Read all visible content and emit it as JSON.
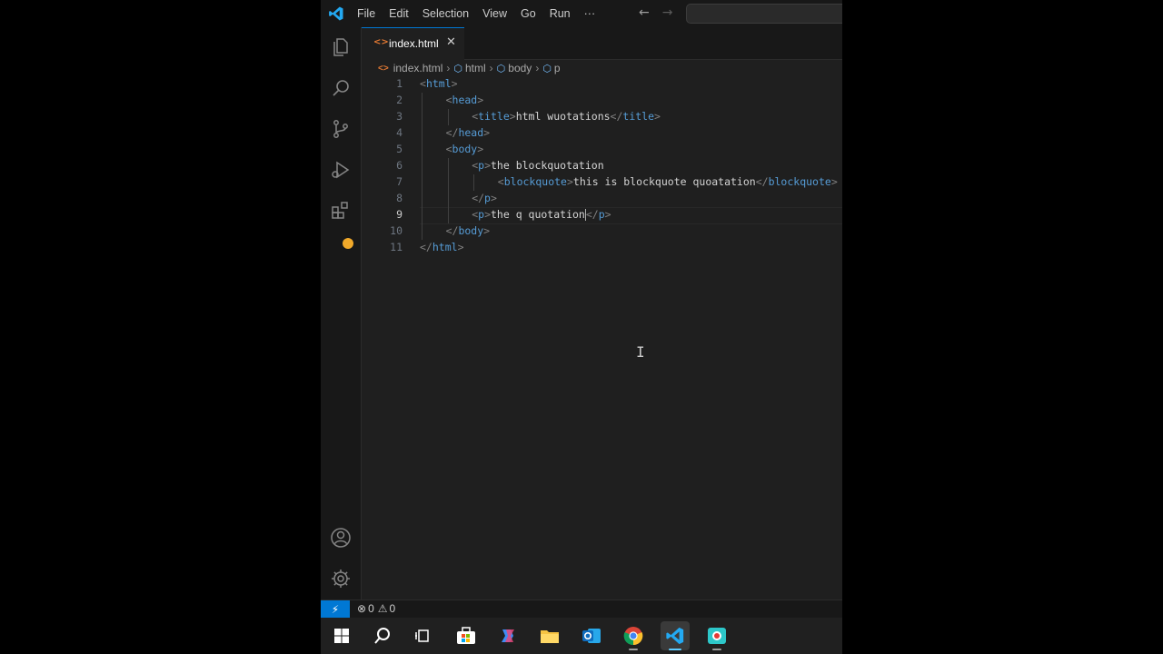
{
  "titlebar": {
    "menu": [
      "File",
      "Edit",
      "Selection",
      "View",
      "Go",
      "Run",
      "···"
    ]
  },
  "activity_bar": {
    "icons": [
      "explorer-icon",
      "search-icon",
      "source-control-icon",
      "run-debug-icon",
      "extensions-icon",
      "accounts-icon",
      "settings-gear-icon"
    ]
  },
  "tab": {
    "name": "index.html",
    "close": "✕"
  },
  "breadcrumb": [
    "index.html",
    "html",
    "body",
    "p"
  ],
  "editor": {
    "lines": [
      {
        "n": "1",
        "indent": 0,
        "parts": [
          [
            "g",
            "<"
          ],
          [
            "t",
            "html"
          ],
          [
            "g",
            ">"
          ]
        ]
      },
      {
        "n": "2",
        "indent": 1,
        "parts": [
          [
            "g",
            "<"
          ],
          [
            "t",
            "head"
          ],
          [
            "g",
            ">"
          ]
        ]
      },
      {
        "n": "3",
        "indent": 2,
        "parts": [
          [
            "g",
            "<"
          ],
          [
            "t",
            "title"
          ],
          [
            "g",
            ">"
          ],
          [
            "x",
            "html wuotations"
          ],
          [
            "g",
            "</"
          ],
          [
            "t",
            "title"
          ],
          [
            "g",
            ">"
          ]
        ]
      },
      {
        "n": "4",
        "indent": 1,
        "parts": [
          [
            "g",
            "</"
          ],
          [
            "t",
            "head"
          ],
          [
            "g",
            ">"
          ]
        ]
      },
      {
        "n": "5",
        "indent": 1,
        "parts": [
          [
            "g",
            "<"
          ],
          [
            "t",
            "body"
          ],
          [
            "g",
            ">"
          ]
        ]
      },
      {
        "n": "6",
        "indent": 2,
        "parts": [
          [
            "g",
            "<"
          ],
          [
            "t",
            "p"
          ],
          [
            "g",
            ">"
          ],
          [
            "x",
            "the blockquotation"
          ]
        ]
      },
      {
        "n": "7",
        "indent": 3,
        "parts": [
          [
            "g",
            "<"
          ],
          [
            "t",
            "blockquote"
          ],
          [
            "g",
            ">"
          ],
          [
            "x",
            "this is blockquote quoatation"
          ],
          [
            "g",
            "</"
          ],
          [
            "t",
            "blockquote"
          ],
          [
            "g",
            ">"
          ]
        ]
      },
      {
        "n": "8",
        "indent": 2,
        "parts": [
          [
            "g",
            "</"
          ],
          [
            "t",
            "p"
          ],
          [
            "g",
            ">"
          ]
        ]
      },
      {
        "n": "9",
        "indent": 2,
        "current": true,
        "parts": [
          [
            "g",
            "<"
          ],
          [
            "t",
            "p"
          ],
          [
            "g",
            ">"
          ],
          [
            "x",
            "the q quotation"
          ],
          [
            "c",
            ""
          ],
          [
            "g",
            "</"
          ],
          [
            "t",
            "p"
          ],
          [
            "g",
            ">"
          ]
        ]
      },
      {
        "n": "10",
        "indent": 1,
        "parts": [
          [
            "g",
            "</"
          ],
          [
            "t",
            "body"
          ],
          [
            "g",
            ">"
          ]
        ]
      },
      {
        "n": "11",
        "indent": 0,
        "parts": [
          [
            "g",
            "</"
          ],
          [
            "t",
            "html"
          ],
          [
            "g",
            ">"
          ]
        ]
      }
    ]
  },
  "statusbar": {
    "remote": "⚡",
    "errors": "0",
    "warnings": "0"
  },
  "taskbar": {
    "icons": [
      "windows-start-icon",
      "search-icon",
      "task-view-icon",
      "store-icon",
      "copilot-icon",
      "file-explorer-icon",
      "outlook-icon",
      "chrome-icon",
      "vscode-icon",
      "screen-recorder-icon"
    ],
    "active": "vscode-icon"
  },
  "colors": {
    "accent": "#0078d4",
    "tag": "#569cd6",
    "bracket": "#808080",
    "text": "#d4d4d4",
    "linenumber": "#6e7681",
    "html_icon": "#e37933"
  }
}
